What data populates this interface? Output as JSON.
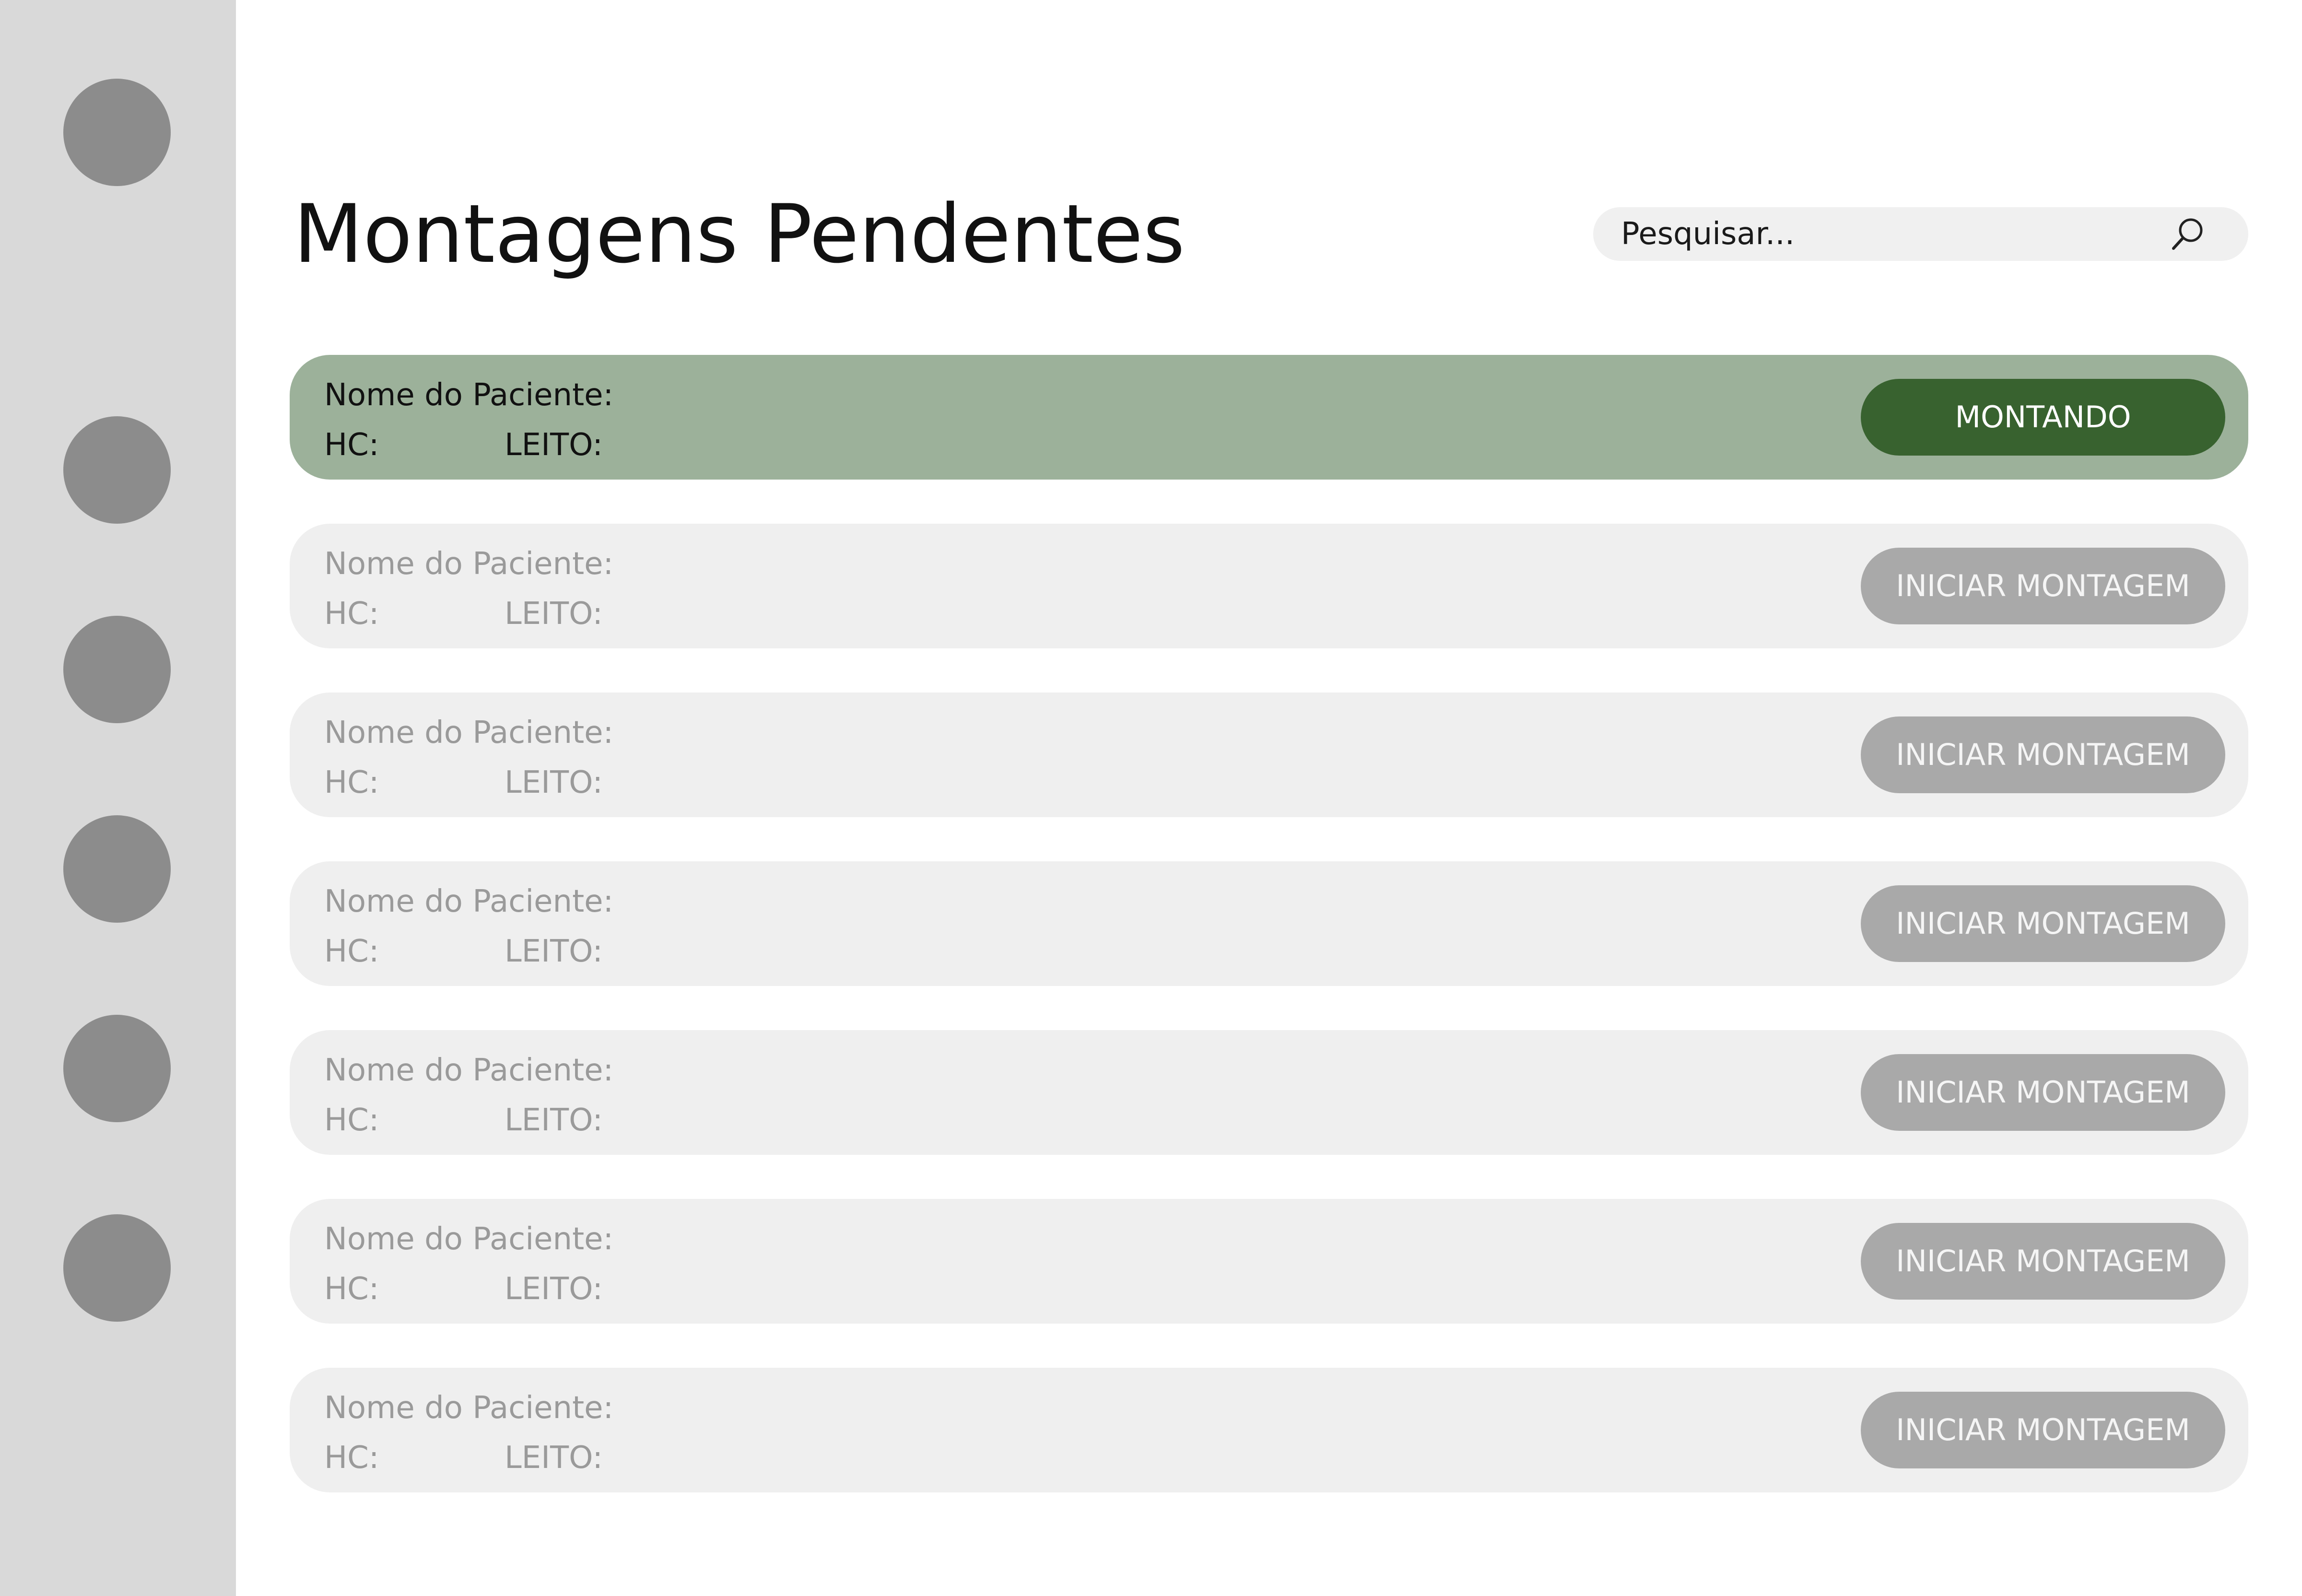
{
  "colors": {
    "sidebar_bg": "#d9d9d9",
    "nav_dot": "#8c8c8c",
    "card_bg": "#efefef",
    "card_active_bg": "#9cb19a",
    "button_bg": "#a9a9a9",
    "button_active_bg": "#38622f"
  },
  "sidebar": {
    "items": [
      {
        "icon": "circle"
      },
      {
        "icon": "circle"
      },
      {
        "icon": "circle"
      },
      {
        "icon": "circle"
      },
      {
        "icon": "circle"
      },
      {
        "icon": "circle"
      }
    ]
  },
  "header": {
    "title": "Montagens Pendentes"
  },
  "search": {
    "placeholder": "Pesquisar...",
    "icon": "search-icon"
  },
  "patients": [
    {
      "name_label": "Nome do Paciente:",
      "hc_label": "HC:",
      "leito_label": "LEITO:",
      "button_label": "MONTANDO",
      "active": true
    },
    {
      "name_label": "Nome do Paciente:",
      "hc_label": "HC:",
      "leito_label": "LEITO:",
      "button_label": "INICIAR MONTAGEM",
      "active": false
    },
    {
      "name_label": "Nome do Paciente:",
      "hc_label": "HC:",
      "leito_label": "LEITO:",
      "button_label": "INICIAR MONTAGEM",
      "active": false
    },
    {
      "name_label": "Nome do Paciente:",
      "hc_label": "HC:",
      "leito_label": "LEITO:",
      "button_label": "INICIAR MONTAGEM",
      "active": false
    },
    {
      "name_label": "Nome do Paciente:",
      "hc_label": "HC:",
      "leito_label": "LEITO:",
      "button_label": "INICIAR MONTAGEM",
      "active": false
    },
    {
      "name_label": "Nome do Paciente:",
      "hc_label": "HC:",
      "leito_label": "LEITO:",
      "button_label": "INICIAR MONTAGEM",
      "active": false
    },
    {
      "name_label": "Nome do Paciente:",
      "hc_label": "HC:",
      "leito_label": "LEITO:",
      "button_label": "INICIAR MONTAGEM",
      "active": false
    }
  ]
}
